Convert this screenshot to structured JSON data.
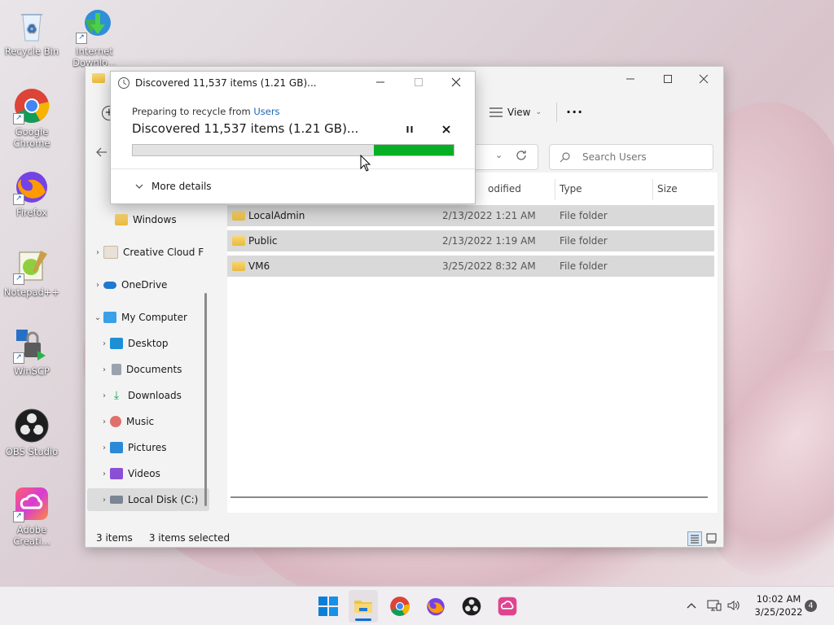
{
  "desktop": {
    "icons": [
      {
        "label": "Recycle Bin"
      },
      {
        "label": "Internet Downlo..."
      },
      {
        "label": "Google Chrome"
      },
      {
        "label": "Firefox"
      },
      {
        "label": "Notepad++"
      },
      {
        "label": "WinSCP"
      },
      {
        "label": "OBS Studio"
      },
      {
        "label": "Adobe Creati..."
      }
    ]
  },
  "explorer": {
    "toolbar": {
      "view_label": "View",
      "more_label": "···"
    },
    "search_placeholder": "Search Users",
    "nav": {
      "items": [
        {
          "label": "Windows"
        },
        {
          "label": "Creative Cloud F"
        },
        {
          "label": "OneDrive"
        },
        {
          "label": "My Computer"
        },
        {
          "label": "Desktop"
        },
        {
          "label": "Documents"
        },
        {
          "label": "Downloads"
        },
        {
          "label": "Music"
        },
        {
          "label": "Pictures"
        },
        {
          "label": "Videos"
        },
        {
          "label": "Local Disk (C:)"
        }
      ]
    },
    "columns": {
      "modified": "odified",
      "type": "Type",
      "size": "Size"
    },
    "rows": [
      {
        "name": "LocalAdmin",
        "date": "2/13/2022 1:21 AM",
        "type": "File folder"
      },
      {
        "name": "Public",
        "date": "2/13/2022 1:19 AM",
        "type": "File folder"
      },
      {
        "name": "VM6",
        "date": "3/25/2022 8:32 AM",
        "type": "File folder"
      }
    ],
    "status": {
      "count": "3 items",
      "selected": "3 items selected"
    }
  },
  "dialog": {
    "title": "Discovered 11,537 items (1.21 GB)...",
    "preparing_prefix": "Preparing to recycle from",
    "preparing_link": "Users",
    "headline": "Discovered 11,537 items (1.21 GB)...",
    "progress_fraction": 0.25,
    "more_details": "More details",
    "progress_color": "#06b025"
  },
  "taskbar": {
    "time": "10:02 AM",
    "date": "3/25/2022",
    "notification_count": "4"
  }
}
